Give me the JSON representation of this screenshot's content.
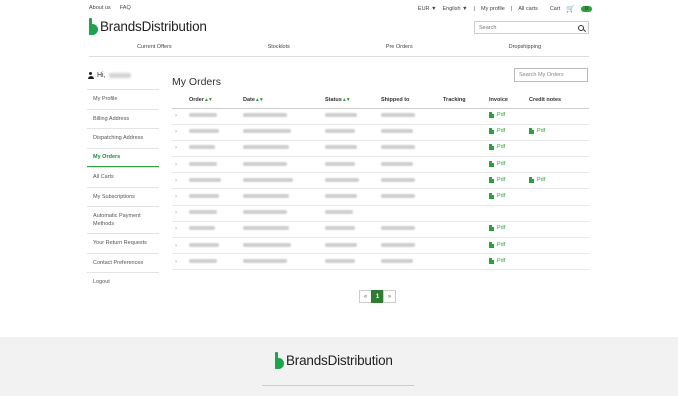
{
  "topbar": {
    "about": "About us",
    "faq": "FAQ",
    "currency": "EUR",
    "language": "English",
    "profile": "My profile",
    "all_carts": "All carts",
    "cart": "Cart",
    "cart_count": "0"
  },
  "logo": {
    "text": "BrandsDistribution"
  },
  "search": {
    "placeholder": "Search"
  },
  "nav": [
    "Current Offers",
    "Stocklots",
    "Pre Orders",
    "Dropshipping"
  ],
  "sidebar": {
    "greeting": "Hi,",
    "items": [
      "My Profile",
      "Billing Address",
      "Dispatching Address",
      "My Orders",
      "All Carts",
      "My Subscriptions",
      "Automatic Payment Methods",
      "Your Return Requests",
      "Contact Preferences",
      "Logout"
    ]
  },
  "main": {
    "title": "My Orders",
    "search_placeholder": "Search My Orders",
    "columns": {
      "order": "Order",
      "date": "Date",
      "status": "Status",
      "shipped": "Shipped to",
      "tracking": "Tracking",
      "invoice": "Invoice",
      "credit": "Credit notes"
    },
    "pdf_label": "Pdf",
    "rows": [
      {
        "invoice": true,
        "credit": false
      },
      {
        "invoice": true,
        "credit": true
      },
      {
        "invoice": true,
        "credit": false
      },
      {
        "invoice": true,
        "credit": false
      },
      {
        "invoice": true,
        "credit": true
      },
      {
        "invoice": true,
        "credit": false
      },
      {
        "invoice": false,
        "credit": false
      },
      {
        "invoice": true,
        "credit": false
      },
      {
        "invoice": true,
        "credit": false
      },
      {
        "invoice": true,
        "credit": false
      }
    ]
  },
  "pagination": {
    "prev": "«",
    "current": "1",
    "next": "»"
  },
  "colors": {
    "accent": "#2e9e3e",
    "brand": "#1ea24a"
  }
}
